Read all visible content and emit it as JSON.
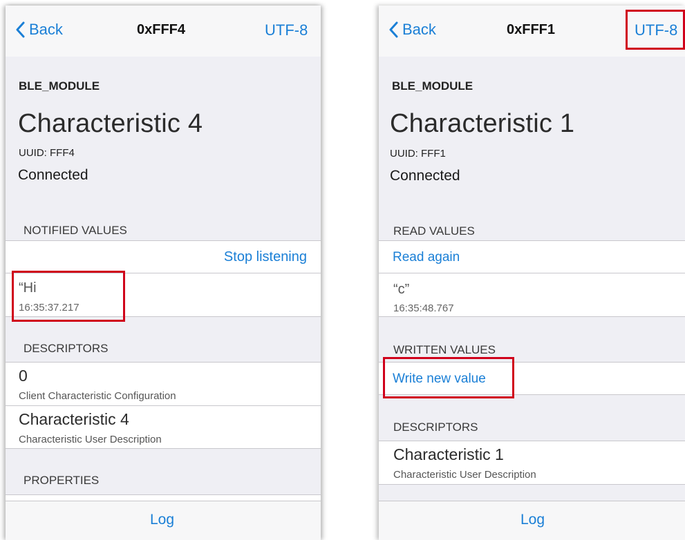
{
  "left": {
    "nav": {
      "back_label": "Back",
      "title": "0xFFF4",
      "right_label": "UTF-8"
    },
    "module": "BLE_MODULE",
    "characteristic_title": "Characteristic 4",
    "uuid": "UUID: FFF4",
    "status": "Connected",
    "notified_header": "NOTIFIED VALUES",
    "stop_listening": "Stop listening",
    "notified_value": "“Hi",
    "notified_time": "16:35:37.217",
    "descriptors_header": "DESCRIPTORS",
    "descriptors": [
      {
        "name": "0",
        "sub": "Client Characteristic Configuration"
      },
      {
        "name": "Characteristic 4",
        "sub": "Characteristic User Description"
      }
    ],
    "properties_header": "PROPERTIES",
    "tab_log": "Log"
  },
  "right": {
    "nav": {
      "back_label": "Back",
      "title": "0xFFF1",
      "right_label": "UTF-8"
    },
    "module": "BLE_MODULE",
    "characteristic_title": "Characteristic 1",
    "uuid": "UUID: FFF1",
    "status": "Connected",
    "read_header": "READ VALUES",
    "read_again": "Read again",
    "read_value": "“c”",
    "read_time": "16:35:48.767",
    "written_header": "WRITTEN VALUES",
    "write_new_value": "Write new value",
    "descriptors_header": "DESCRIPTORS",
    "descriptors": [
      {
        "name": "Characteristic 1",
        "sub": "Characteristic User Description"
      }
    ],
    "tab_log": "Log"
  },
  "colors": {
    "accent": "#1a7fd6",
    "highlight": "#d0021b",
    "background": "#efeff4"
  }
}
